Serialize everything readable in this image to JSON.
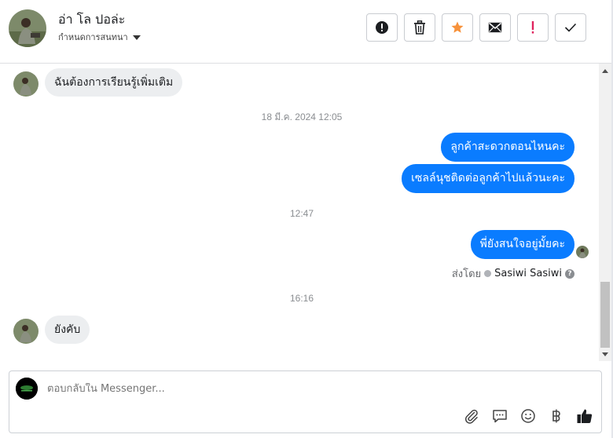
{
  "header": {
    "contact_name": "อ่า โล ปอล่ะ",
    "assign_label": "กำหนดการสนทนา",
    "actions": [
      {
        "name": "spam-button",
        "icon": "exclamation-circle-icon"
      },
      {
        "name": "delete-button",
        "icon": "trash-icon"
      },
      {
        "name": "star-button",
        "icon": "star-icon",
        "color": "#f7923b"
      },
      {
        "name": "mark-unread-button",
        "icon": "envelope-icon"
      },
      {
        "name": "follow-up-button",
        "icon": "exclamation-icon",
        "color": "#e0245e"
      },
      {
        "name": "done-button",
        "icon": "check-icon"
      }
    ]
  },
  "messages": {
    "m1": "ฉันต้องการเรียนรู้เพิ่มเติม",
    "ts1": "18 มี.ค. 2024 12:05",
    "m2": "ลูกค้าสะดวกตอนไหนคะ",
    "m3": "เซลล์นุชติดต่อลูกค้าไปแล้วนะคะ",
    "ts2": "12:47",
    "m4": "พี่ยังสนใจอยู่มั้ยคะ",
    "sent_by_label": "ส่งโดย",
    "sent_by_name": "Sasiwi Sasiwi",
    "ts3": "16:16",
    "m5": "ยังคับ"
  },
  "composer": {
    "placeholder": "ตอบกลับใน Messenger...",
    "tools": [
      "paperclip-icon",
      "saved-reply-icon",
      "emoji-icon",
      "baht-icon",
      "thumbs-up-icon"
    ]
  },
  "colors": {
    "outgoing_bubble": "#0a7cff",
    "incoming_bubble": "#eceef0"
  }
}
